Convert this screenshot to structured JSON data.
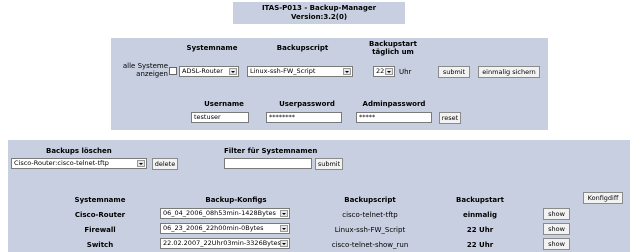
{
  "header": {
    "title": "ITAS-P013 - Backup-Manager",
    "version": "Version:3.2(0)"
  },
  "config_form": {
    "show_all_label_1": "alle Systeme",
    "show_all_label_2": "anzeigen",
    "systemname_header": "Systemname",
    "backupscript_header": "Backupscript",
    "backupstart_header_1": "Backupstart",
    "backupstart_header_2": "täglich um",
    "system_select": "ADSL-Router",
    "script_select": "Linux-ssh-FW_Script",
    "hour_select": "22",
    "hour_unit": "Uhr",
    "submit_label": "submit",
    "once_label": "einmalig sichern",
    "username_header": "Username",
    "userpassword_header": "Userpassword",
    "adminpassword_header": "Adminpassword",
    "username_value": "testuser",
    "userpassword_value": "********",
    "adminpassword_value": "*****",
    "reset_label": "reset"
  },
  "delete_form": {
    "header": "Backups löschen",
    "select_value": "Cisco-Router:cisco-telnet-tftp",
    "delete_label": "delete"
  },
  "filter_form": {
    "header": "Filter für Systemnamen",
    "input_value": "",
    "submit_label": "submit"
  },
  "table": {
    "headers": [
      "Systemname",
      "Backup-Konfigs",
      "Backupscript",
      "Backupstart"
    ],
    "konfigdiff_label": "Konfigdiff",
    "show_label": "show",
    "rows": [
      {
        "system": "Cisco-Router",
        "konfig": "06_04_2006_08h53min-1428Bytes",
        "script": "cisco-telnet-tftp",
        "start": "einmalig"
      },
      {
        "system": "Firewall",
        "konfig": "06_23_2006_22h00min-0Bytes",
        "script": "Linux-ssh-FW_Script",
        "start": "22 Uhr"
      },
      {
        "system": "Switch",
        "konfig": "22.02.2007_22Uhr03min-3326Bytes",
        "script": "cisco-telnet-show_run",
        "start": "22 Uhr"
      }
    ]
  }
}
